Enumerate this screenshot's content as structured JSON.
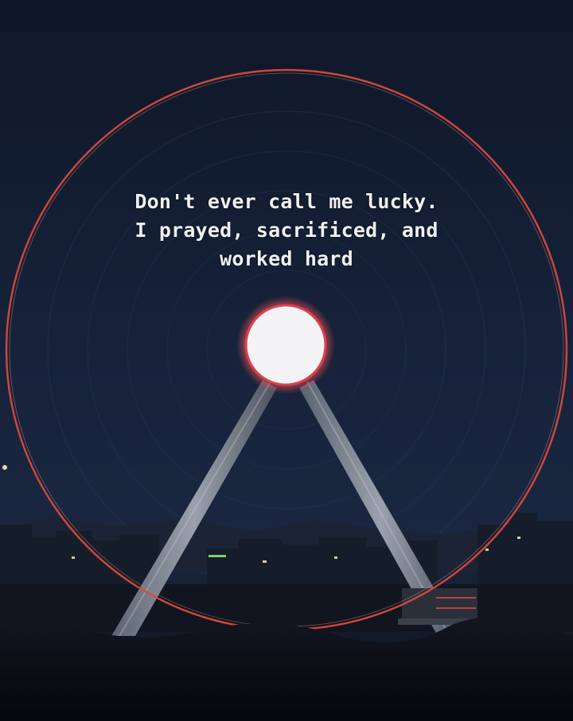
{
  "quote": {
    "lines": [
      "Don't ever call me lucky.",
      "I prayed, sacrificed, and",
      "worked hard"
    ]
  },
  "scene": {
    "subject": "ferris-wheel-long-exposure-night",
    "colors": {
      "sky_top": "#111a2a",
      "sky_mid": "#17243b",
      "rim_light": "#d94a3e",
      "hub_light": "#f2f2f4",
      "hub_glow": "#e0404a",
      "ground": "#07090d"
    }
  }
}
